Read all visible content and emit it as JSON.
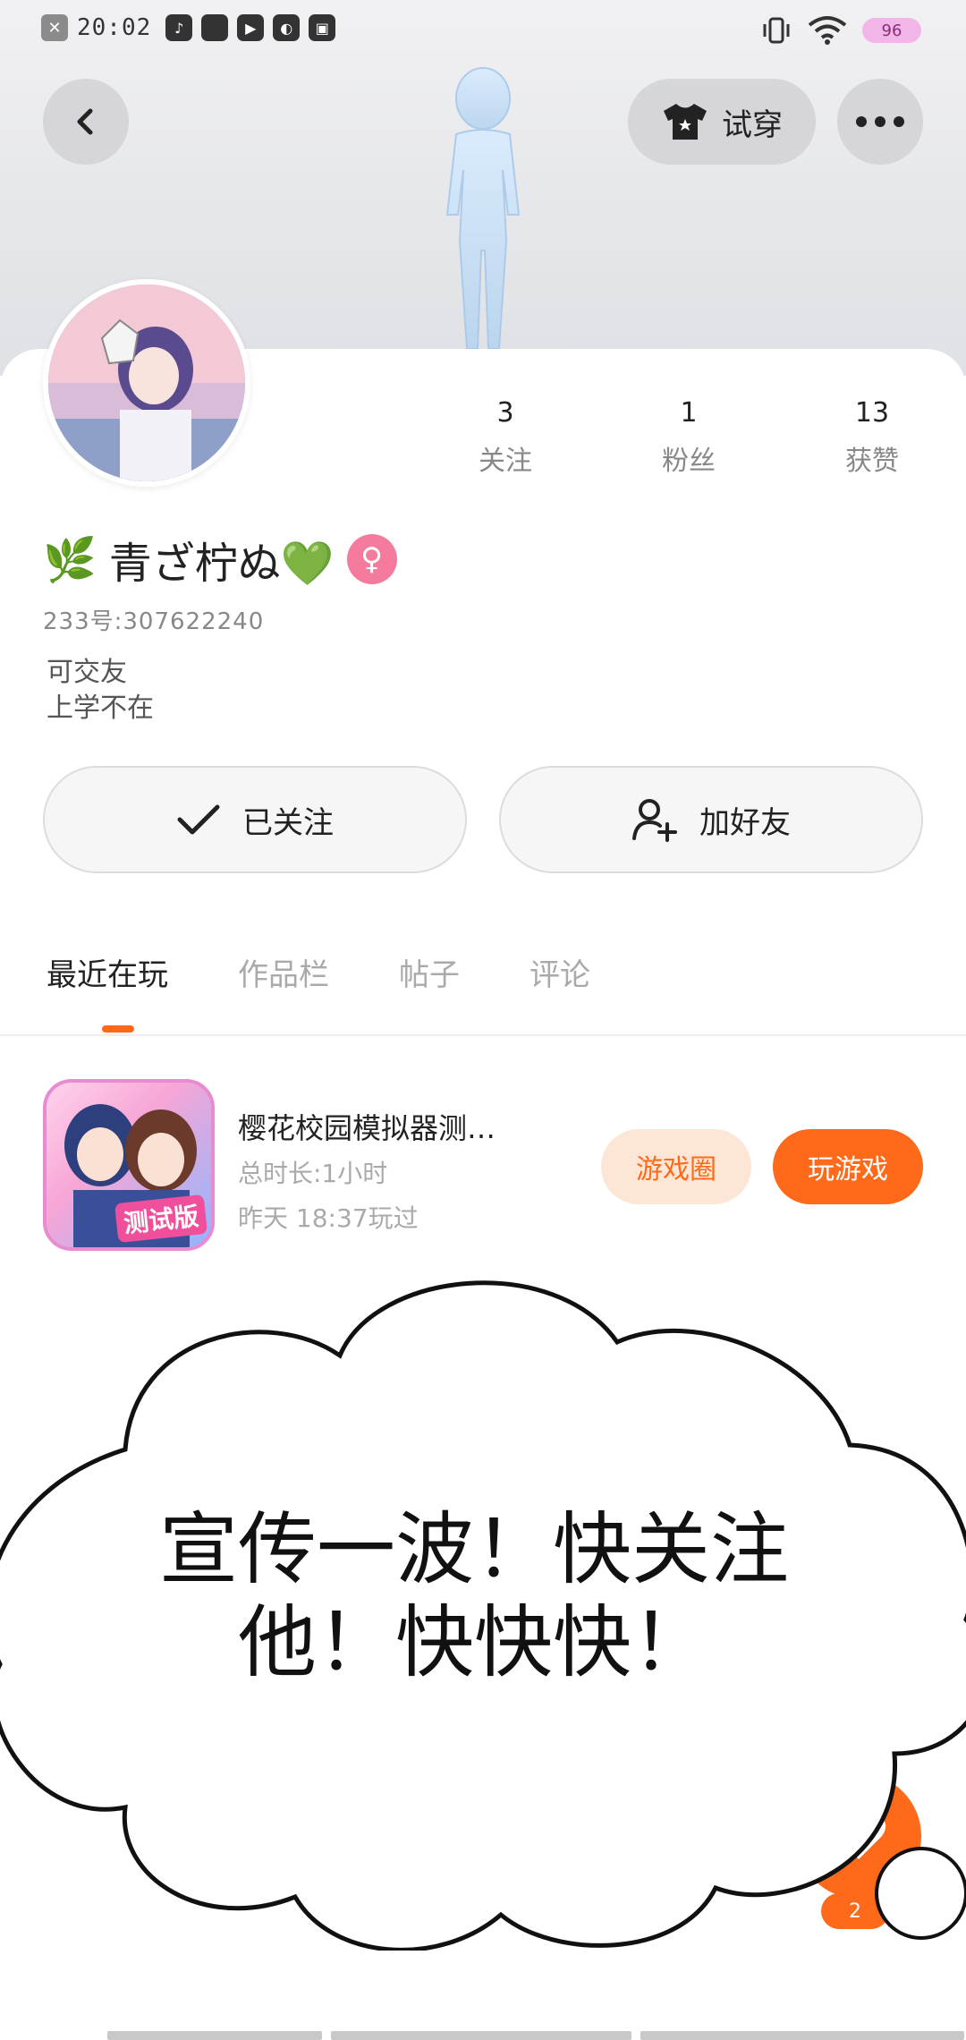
{
  "status_bar": {
    "time": "20:02",
    "battery": "96"
  },
  "header": {
    "try_on_label": "试穿"
  },
  "profile": {
    "name": "青ざ柠ぬ💚",
    "name_prefix_icon": "🌿",
    "uid": "233号:307622240",
    "bio_lines": [
      "可交友",
      "上学不在"
    ],
    "gender_icon": "♀",
    "stats": [
      {
        "value": "3",
        "label": "关注"
      },
      {
        "value": "1",
        "label": "粉丝"
      },
      {
        "value": "13",
        "label": "获赞"
      }
    ]
  },
  "actions": {
    "followed_label": "已关注",
    "add_friend_label": "加好友"
  },
  "tabs": [
    {
      "label": "最近在玩",
      "active": true
    },
    {
      "label": "作品栏",
      "active": false
    },
    {
      "label": "帖子",
      "active": false
    },
    {
      "label": "评论",
      "active": false
    }
  ],
  "recent_game": {
    "name": "樱花校园模拟器测…",
    "duration": "总时长:1小时",
    "last_played": "昨天 18:37玩过",
    "icon_badge": "测试版",
    "circle_button": "游戏圈",
    "play_button": "玩游戏"
  },
  "overlay": {
    "cloud_text_line1": "宣传一波！快关注",
    "cloud_text_line2": "他！快快快！"
  },
  "like": {
    "count": "2"
  },
  "colors": {
    "accent": "#ff6a1a",
    "accent_light": "#fde6d6",
    "gender_pink": "#f47b9d"
  }
}
